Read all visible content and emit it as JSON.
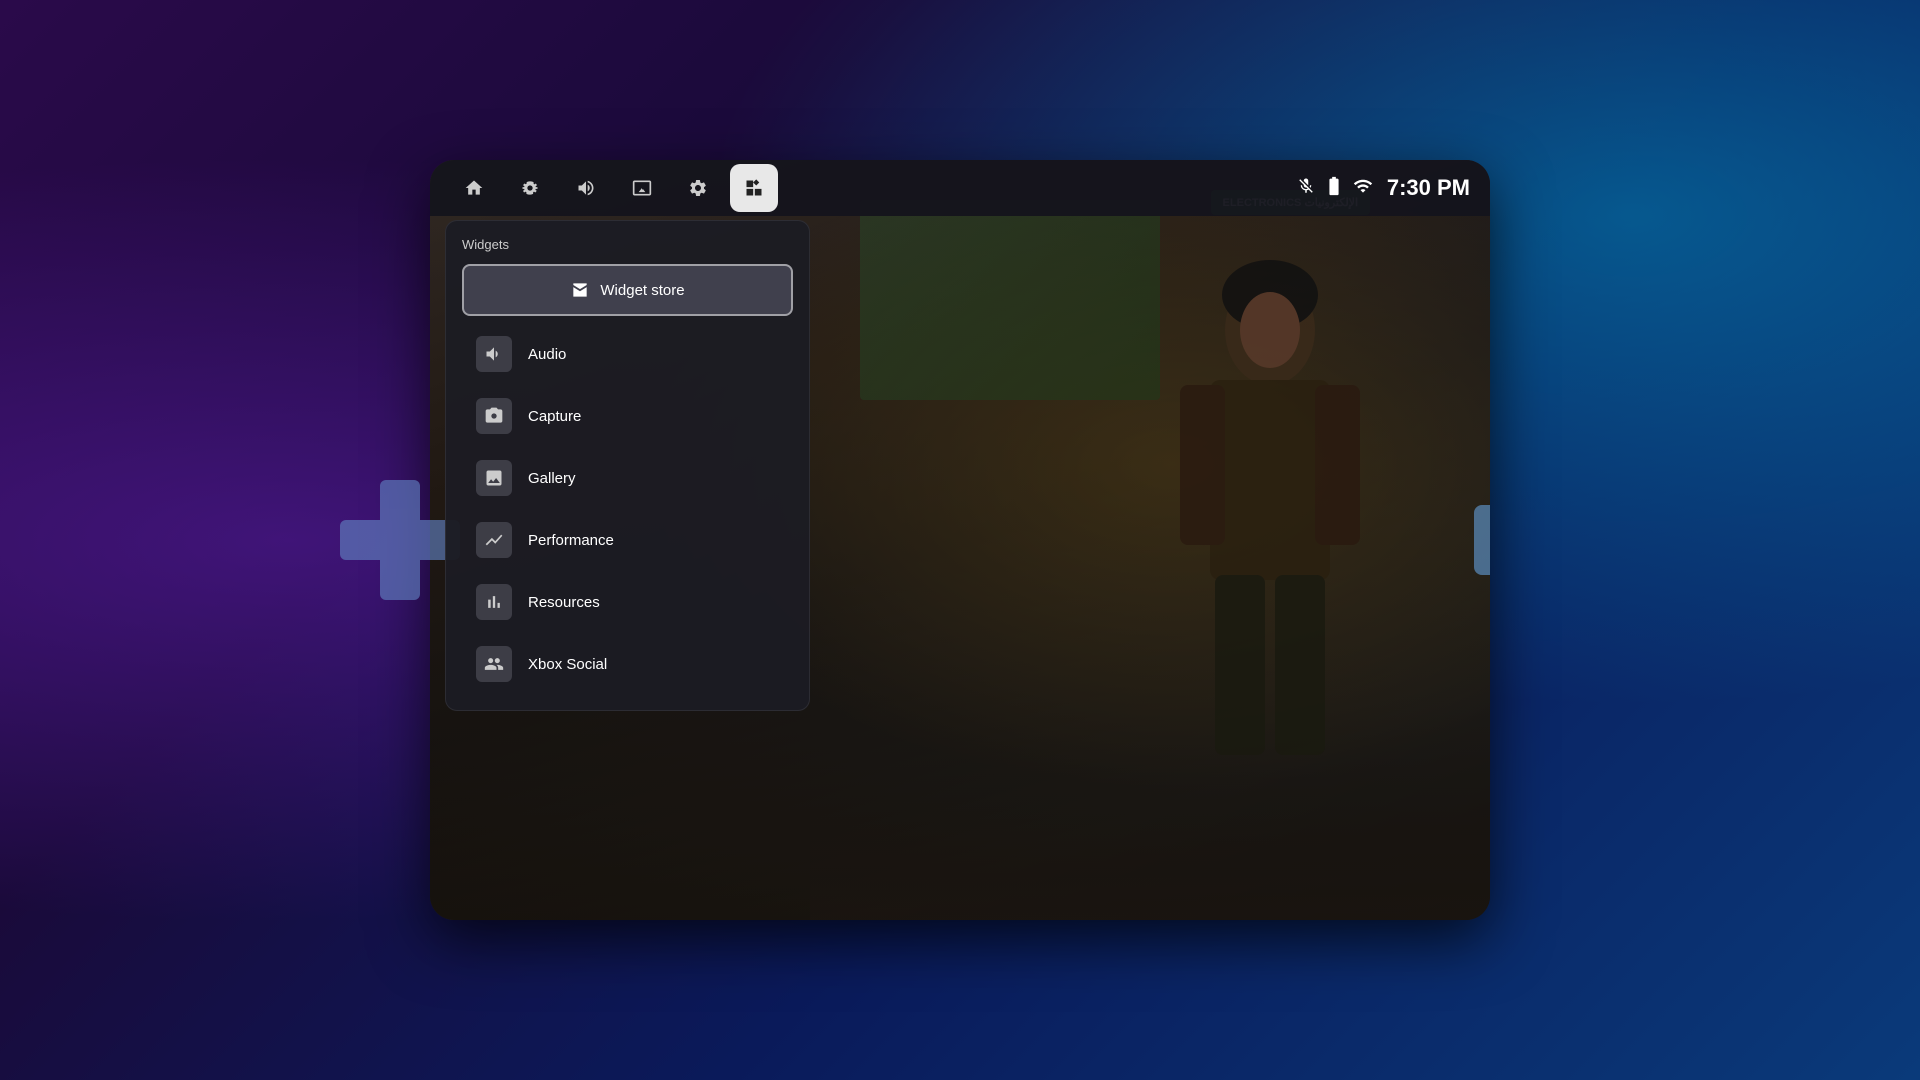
{
  "background": {
    "gradient_from": "#2a0a4a",
    "gradient_to": "#0a3a7a"
  },
  "device": {
    "electronics_sign": "ELECTRONICS\nالإلكترونيات"
  },
  "navbar": {
    "icons": [
      {
        "name": "home",
        "label": "Home",
        "active": false
      },
      {
        "name": "capture",
        "label": "Capture",
        "active": false
      },
      {
        "name": "audio",
        "label": "Audio",
        "active": false
      },
      {
        "name": "gallery",
        "label": "Gallery",
        "active": false
      },
      {
        "name": "settings",
        "label": "Settings",
        "active": false
      },
      {
        "name": "widgets",
        "label": "Widgets",
        "active": true
      }
    ],
    "time": "7:30 PM",
    "mute_icon": "mic-mute",
    "battery_icon": "battery",
    "wifi_icon": "wifi"
  },
  "widget_panel": {
    "section_label": "Widgets",
    "store_button_label": "Widget store",
    "items": [
      {
        "id": "audio",
        "label": "Audio",
        "icon": "speaker"
      },
      {
        "id": "capture",
        "label": "Capture",
        "icon": "camera"
      },
      {
        "id": "gallery",
        "label": "Gallery",
        "icon": "gallery"
      },
      {
        "id": "performance",
        "label": "Performance",
        "icon": "performance"
      },
      {
        "id": "resources",
        "label": "Resources",
        "icon": "bar-chart"
      },
      {
        "id": "xbox-social",
        "label": "Xbox Social",
        "icon": "people"
      }
    ]
  }
}
